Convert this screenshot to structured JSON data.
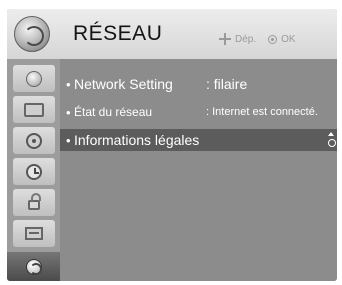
{
  "header": {
    "title": "RÉSEAU",
    "move_hint": "Dép.",
    "ok_hint": "OK",
    "icon": "network-globe-icon"
  },
  "sidebar": {
    "items": [
      {
        "icon": "picture-icon"
      },
      {
        "icon": "tv-screen-icon"
      },
      {
        "icon": "audio-icon"
      },
      {
        "icon": "clock-icon"
      },
      {
        "icon": "lock-icon"
      },
      {
        "icon": "options-icon"
      },
      {
        "icon": "network-icon",
        "active": true
      }
    ]
  },
  "menu": {
    "items": [
      {
        "bullet": "•",
        "label": "Network Setting",
        "value": ": filaire"
      },
      {
        "bullet": "•",
        "label": "État du réseau",
        "value": ": Internet est connecté."
      },
      {
        "bullet": "•",
        "label": "Informations légales",
        "value": "",
        "selected": true
      }
    ]
  },
  "colors": {
    "header_bg": "#e2e2e2",
    "content_bg": "#8c8c8c",
    "selected_bg": "#5c5c5c",
    "text": "#ffffff"
  }
}
